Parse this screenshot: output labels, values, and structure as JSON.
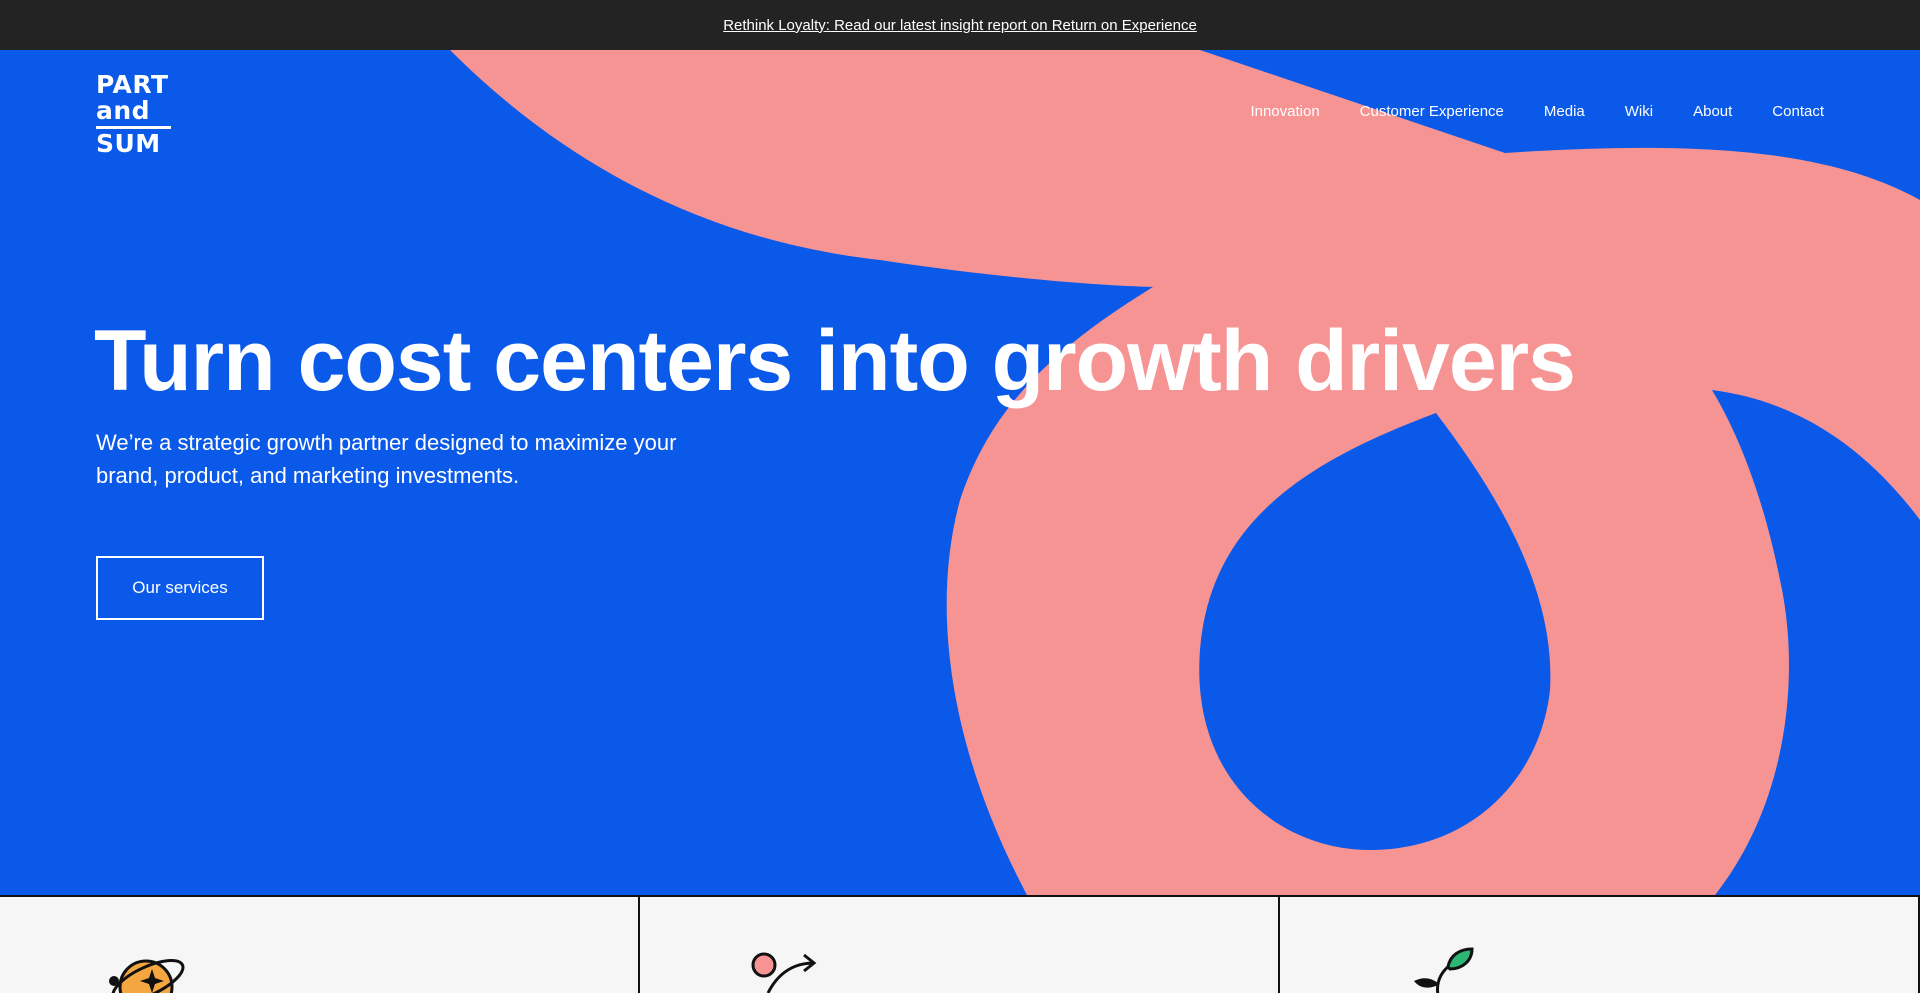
{
  "announcement": {
    "link_text": "Rethink Loyalty: Read our latest insight report on Return on Experience"
  },
  "brand": {
    "logo_line1": "PART",
    "logo_line2": "and",
    "logo_line3": "SUM"
  },
  "nav": {
    "items": [
      {
        "label": "Innovation"
      },
      {
        "label": "Customer Experience"
      },
      {
        "label": "Media"
      },
      {
        "label": "Wiki"
      },
      {
        "label": "About"
      },
      {
        "label": "Contact"
      }
    ]
  },
  "hero": {
    "headline": "Turn cost centers into growth drivers",
    "subheadline": "We’re a strategic growth partner designed to maximize your brand, product, and marketing investments.",
    "cta_label": "Our services"
  },
  "cards": [
    {
      "icon": "planet-star-icon"
    },
    {
      "icon": "arrow-path-icon"
    },
    {
      "icon": "sprout-icon"
    }
  ],
  "colors": {
    "announcement_bg": "#232323",
    "hero_blue": "#0a59e9",
    "decor_pink": "#f69494",
    "card_bg": "#f6f6f6",
    "text_light": "#ffffff"
  }
}
